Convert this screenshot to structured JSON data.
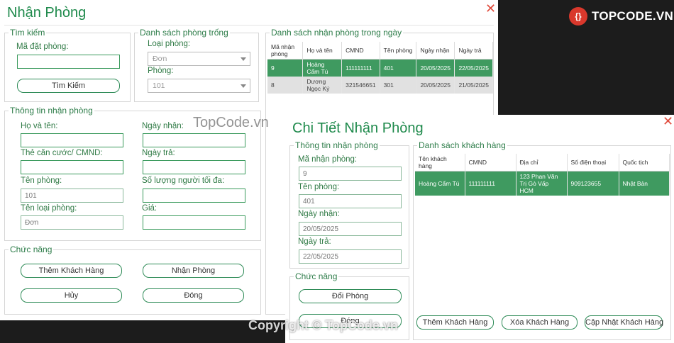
{
  "brand": {
    "logo_text": "TOPCODE.VN",
    "badge_glyph": "{}",
    "watermark": "TopCode.vn",
    "copyright": "Copyright © TopCode.vn"
  },
  "main_window": {
    "title": "Nhận Phòng",
    "close_glyph": "✕",
    "search": {
      "legend": "Tìm kiếm",
      "booking_code_label": "Mã đặt phòng:",
      "booking_code_value": "",
      "search_button": "Tìm Kiếm"
    },
    "empty_rooms": {
      "legend": "Danh sách phòng trống",
      "room_type_label": "Loại phòng:",
      "room_type_value": "Đơn",
      "room_label": "Phòng:",
      "room_value": "101"
    },
    "checkin_list": {
      "legend": "Danh sách nhận phòng trong ngày",
      "columns": [
        "Mã nhận phòng",
        "Họ và tên",
        "CMND",
        "Tên phòng",
        "Ngày nhận",
        "Ngày trả"
      ],
      "rows": [
        [
          "9",
          "Hoàng Cẩm Tú",
          "111111111",
          "401",
          "20/05/2025",
          "22/05/2025"
        ],
        [
          "8",
          "Dương Ngọc Ký",
          "321546651",
          "301",
          "20/05/2025",
          "21/05/2025"
        ]
      ]
    },
    "info": {
      "legend": "Thông tin nhận phòng",
      "fullname_label": "Họ và tên:",
      "fullname_value": "",
      "idcard_label": "Thẻ căn cước/ CMND:",
      "idcard_value": "",
      "room_name_label": "Tên phòng:",
      "room_name_value": "101",
      "room_type_label": "Tên loại phòng:",
      "room_type_value": "Đơn",
      "checkin_date_label": "Ngày nhận:",
      "checkin_date_value": "",
      "checkout_date_label": "Ngày trả:",
      "checkout_date_value": "",
      "max_people_label": "Số lượng người tối đa:",
      "max_people_value": "",
      "price_label": "Giá:",
      "price_value": ""
    },
    "functions": {
      "legend": "Chức năng",
      "add_customer": "Thêm Khách Hàng",
      "checkin": "Nhận Phòng",
      "cancel": "Hủy",
      "close": "Đóng"
    }
  },
  "detail_window": {
    "title": "Chi Tiết Nhận Phòng",
    "close_glyph": "✕",
    "info": {
      "legend": "Thông tin nhận phòng",
      "checkin_code_label": "Mã nhận phòng:",
      "checkin_code_value": "9",
      "room_name_label": "Tên phòng:",
      "room_name_value": "401",
      "checkin_date_label": "Ngày nhận:",
      "checkin_date_value": "20/05/2025",
      "checkout_date_label": "Ngày trả:",
      "checkout_date_value": "22/05/2025"
    },
    "functions": {
      "legend": "Chức năng",
      "change_room": "Đổi Phòng",
      "close": "Đóng"
    },
    "customers": {
      "legend": "Danh sách khách hàng",
      "columns": [
        "Tên khách hàng",
        "CMND",
        "Địa chỉ",
        "Số điện thoại",
        "Quốc tịch"
      ],
      "rows": [
        [
          "Hoàng Cẩm Tú",
          "111111111",
          "123 Phan Văn Trị Gò Vấp HCM",
          "909123655",
          "Nhật Bản"
        ]
      ],
      "add_button": "Thêm Khách Hàng",
      "delete_button": "Xóa Khách Hàng",
      "update_button": "Cập Nhật Khách Hàng"
    }
  },
  "colors": {
    "accent": "#1f8a4c",
    "selected_row": "#3f9a60",
    "close": "#e04b3c"
  }
}
